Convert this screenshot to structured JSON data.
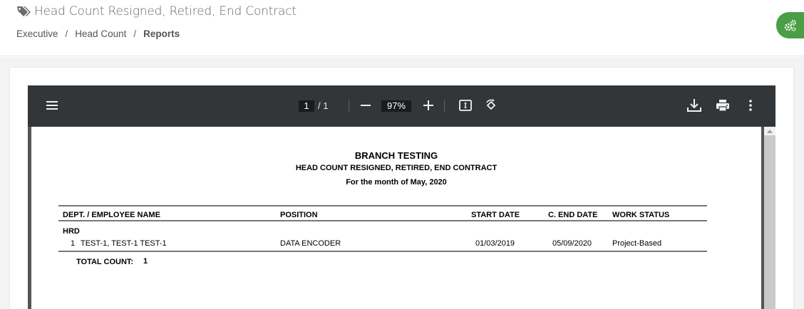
{
  "header": {
    "title": "Head Count Resigned, Retired, End Contract",
    "title_icon": "tags-icon",
    "breadcrumb": [
      "Executive",
      "Head Count",
      "Reports"
    ],
    "breadcrumb_separator": "/"
  },
  "fab": {
    "icon": "cogs-icon",
    "color": "#4a9e45"
  },
  "pdf_toolbar": {
    "current_page": "1",
    "total_pages": "/ 1",
    "zoom": "97%",
    "icons": [
      "menu-icon",
      "zoom-out-icon",
      "zoom-in-icon",
      "fit-page-icon",
      "rotate-icon",
      "download-icon",
      "print-icon",
      "more-icon"
    ]
  },
  "report": {
    "branch": "BRANCH TESTING",
    "title": "HEAD COUNT RESIGNED, RETIRED, END CONTRACT",
    "period": "For the month of May, 2020",
    "columns": [
      "DEPT. / EMPLOYEE NAME",
      "POSITION",
      "START DATE",
      "C. END DATE",
      "WORK STATUS"
    ],
    "department": "HRD",
    "rows": [
      {
        "no": "1",
        "name": "TEST-1, TEST-1 TEST-1",
        "position": "DATA ENCODER",
        "start_date": "01/03/2019",
        "end_date": "05/09/2020",
        "work_status": "Project-Based"
      }
    ],
    "total_label": "TOTAL COUNT:",
    "total_value": "1"
  }
}
